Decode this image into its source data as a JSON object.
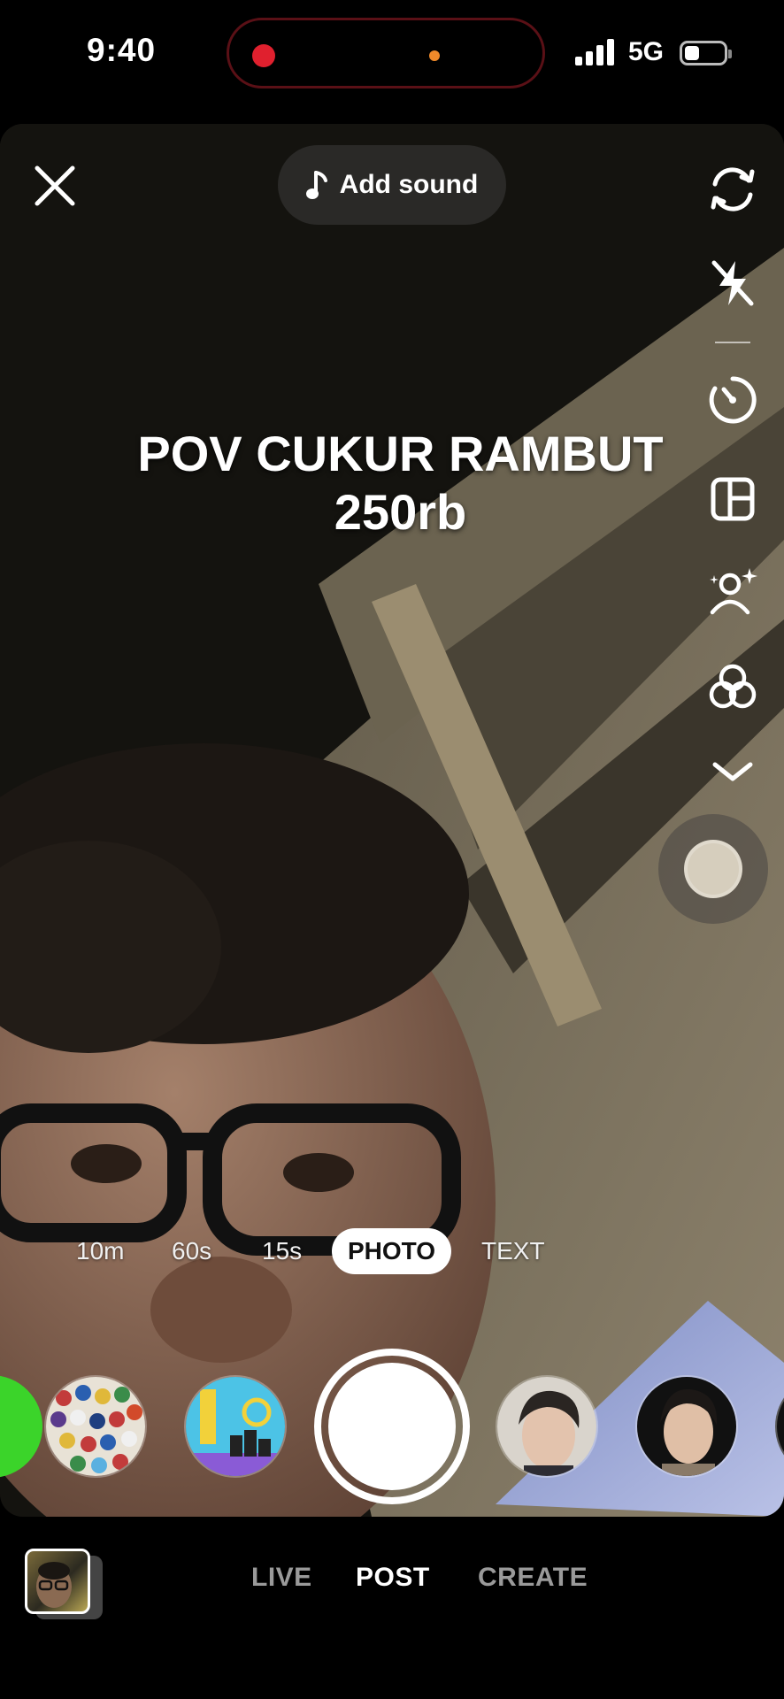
{
  "status_bar": {
    "time": "9:40",
    "network": "5G"
  },
  "top_bar": {
    "add_sound_label": "Add sound"
  },
  "side_tools": [
    {
      "icon": "flip-camera-icon"
    },
    {
      "icon": "flash-off-icon"
    },
    {
      "icon": "timer-icon"
    },
    {
      "icon": "layout-icon"
    },
    {
      "icon": "retouch-icon"
    },
    {
      "icon": "filters-icon"
    },
    {
      "icon": "chevron-down-icon"
    }
  ],
  "caption": {
    "line1": "POV CUKUR RAMBUT",
    "line2": "250rb"
  },
  "modes": [
    "10m",
    "60s",
    "15s",
    "PHOTO",
    "TEXT"
  ],
  "active_mode": "PHOTO",
  "bottom_nav": {
    "tabs": [
      "LIVE",
      "POST",
      "CREATE"
    ],
    "active": "POST"
  },
  "colors": {
    "record_dot": "#e0202e",
    "camera_dot": "#f08a2a",
    "effect_green": "#3bd42a",
    "active_mode_bg": "#ffffff"
  }
}
